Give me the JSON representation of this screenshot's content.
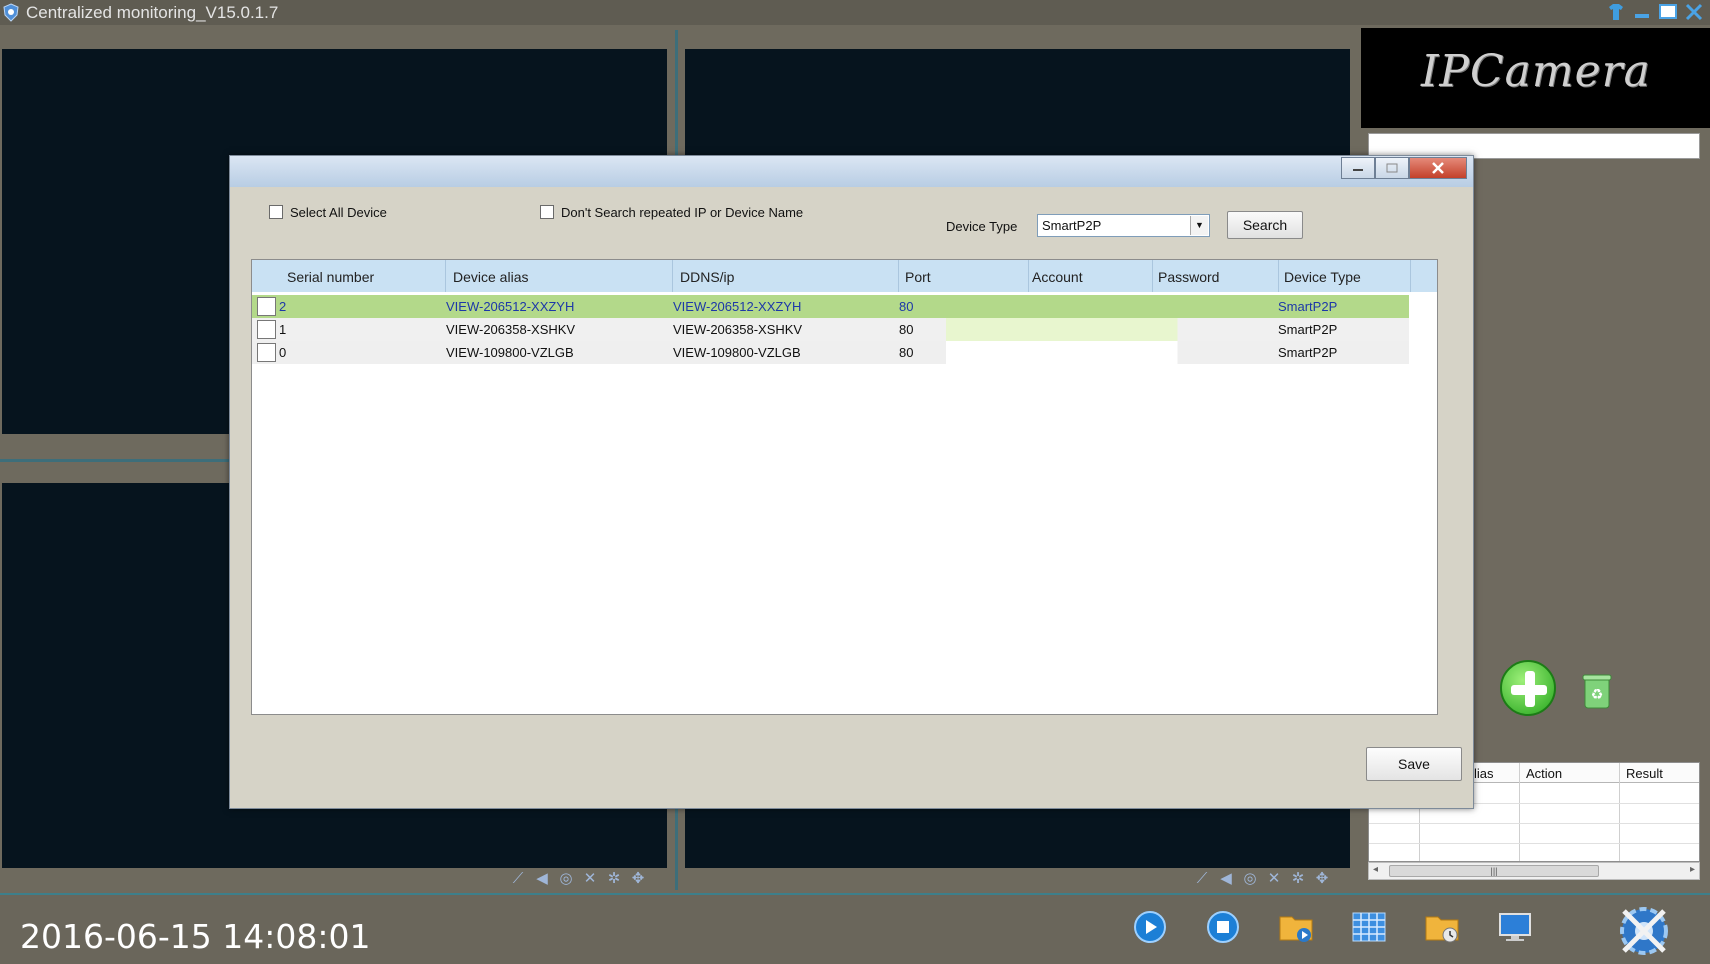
{
  "window": {
    "title": "Centralized monitoring_V15.0.1.7"
  },
  "logo": {
    "text": "IPCamera"
  },
  "right_panel": {
    "log_columns": [
      "lias",
      "Action",
      "Result"
    ]
  },
  "clock": "2016-06-15 14:08:01",
  "dialog": {
    "select_all_label": "Select All Device",
    "dont_search_label": "Don't Search repeated IP or Device Name",
    "device_type_label": "Device Type",
    "device_type_value": "SmartP2P",
    "search_label": "Search",
    "save_label": "Save",
    "columns": [
      "Serial number",
      "Device alias",
      "DDNS/ip",
      "Port",
      "Account",
      "Password",
      "Device Type"
    ],
    "rows": [
      {
        "serial": "2",
        "alias": "VIEW-206512-XXZYH",
        "ddns": "VIEW-206512-XXZYH",
        "port": "80",
        "account": "",
        "password": "",
        "type": "SmartP2P"
      },
      {
        "serial": "1",
        "alias": "VIEW-206358-XSHKV",
        "ddns": "VIEW-206358-XSHKV",
        "port": "80",
        "account": "",
        "password": "",
        "type": "SmartP2P"
      },
      {
        "serial": "0",
        "alias": "VIEW-109800-VZLGB",
        "ddns": "VIEW-109800-VZLGB",
        "port": "80",
        "account": "",
        "password": "",
        "type": "SmartP2P"
      }
    ]
  },
  "colors": {
    "selected_row": "#b3d98a",
    "highlight_row": "#e8f6cf",
    "header_blue": "#c9e1f3",
    "link_text": "#1d38a8"
  }
}
